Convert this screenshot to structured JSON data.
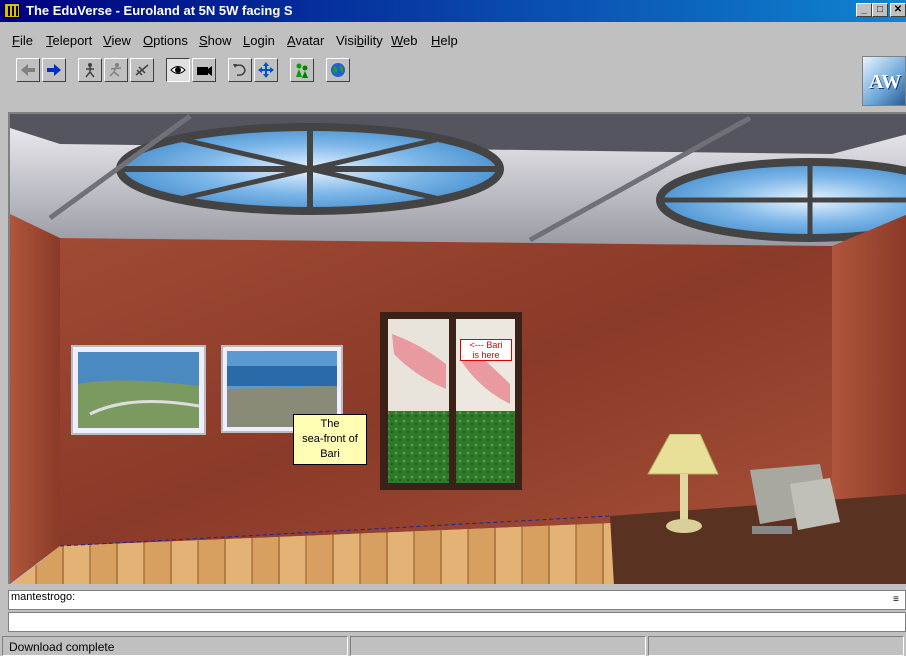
{
  "window": {
    "title": "The EduVerse - Euroland at 5N 5W facing S",
    "controls": {
      "minimize": "_",
      "maximize": "□",
      "close": "✕"
    }
  },
  "menu": [
    {
      "label": "File",
      "accel": "F",
      "rest": "ile"
    },
    {
      "label": "Teleport",
      "accel": "T",
      "rest": "eleport"
    },
    {
      "label": "View",
      "accel": "V",
      "rest": "iew"
    },
    {
      "label": "Options",
      "accel": "O",
      "rest": "ptions"
    },
    {
      "label": "Show",
      "accel": "S",
      "rest": "how"
    },
    {
      "label": "Login",
      "accel": "L",
      "rest": "ogin"
    },
    {
      "label": "Avatar",
      "accel": "A",
      "rest": "vatar"
    },
    {
      "label": "Visibility",
      "accel": "b",
      "pre": "Visi",
      "rest": "ility"
    },
    {
      "label": "Web",
      "accel": "W",
      "rest": "eb"
    },
    {
      "label": "Help",
      "accel": "H",
      "rest": "elp"
    }
  ],
  "toolbar": {
    "icons": [
      "back-arrow-icon",
      "forward-arrow-icon",
      "walk-icon",
      "run-icon",
      "fly-icon",
      "eye-view-icon",
      "camera-view-icon",
      "rotate-icon",
      "move-icon",
      "avatar-icon",
      "globe-icon"
    ],
    "logo_text": "AW"
  },
  "scene": {
    "caption": [
      "The",
      "sea-front of",
      "Bari"
    ],
    "map_note": [
      "<--- Bari",
      "is here"
    ]
  },
  "chat": {
    "line": "mantestrogo:"
  },
  "status": {
    "text": "Download complete"
  }
}
